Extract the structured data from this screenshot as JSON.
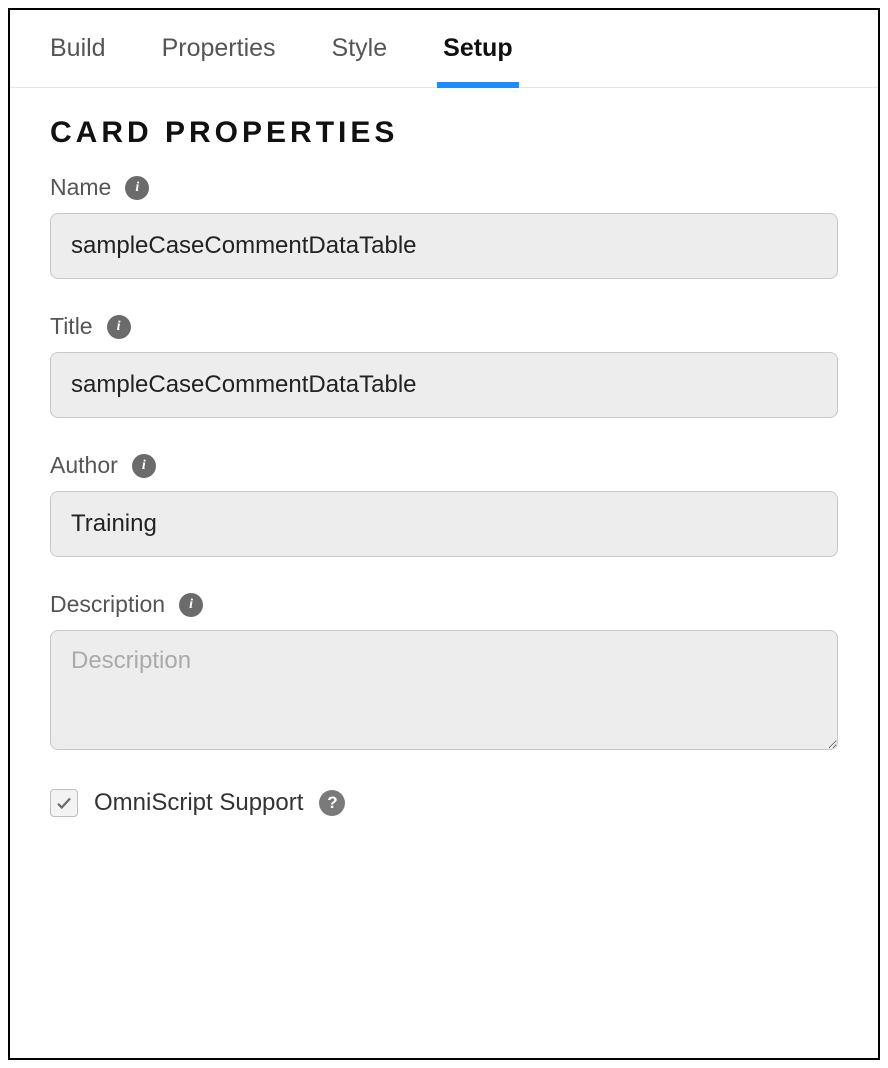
{
  "tabs": [
    {
      "label": "Build",
      "active": false
    },
    {
      "label": "Properties",
      "active": false
    },
    {
      "label": "Style",
      "active": false
    },
    {
      "label": "Setup",
      "active": true
    }
  ],
  "section_title": "CARD PROPERTIES",
  "fields": {
    "name": {
      "label": "Name",
      "value": "sampleCaseCommentDataTable"
    },
    "title": {
      "label": "Title",
      "value": "sampleCaseCommentDataTable"
    },
    "author": {
      "label": "Author",
      "value": "Training"
    },
    "description": {
      "label": "Description",
      "value": "",
      "placeholder": "Description"
    }
  },
  "omniscript": {
    "label": "OmniScript Support",
    "checked": true
  }
}
